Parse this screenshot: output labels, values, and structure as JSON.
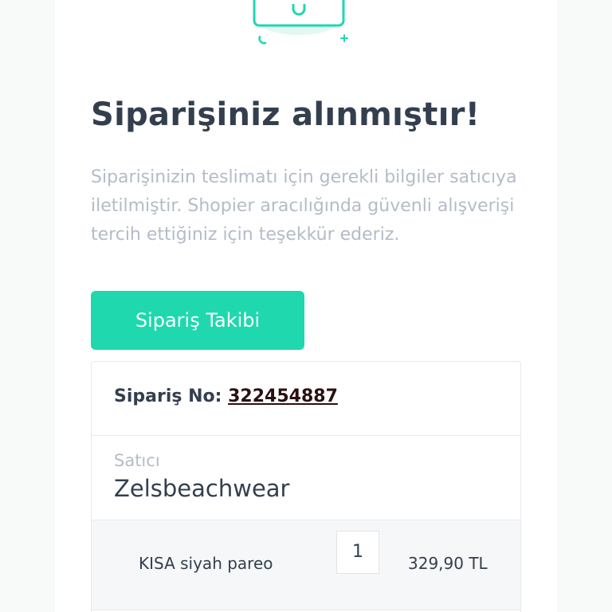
{
  "success": {
    "title": "Siparişiniz alınmıştır!",
    "message": "Siparişinizin teslimatı için gerekli bilgiler satıcıya iletilmiştir. Shopier aracılığında güvenli alışverişi tercih ettiğiniz için teşekkür ederiz.",
    "illustration_icon": "shopping-bag-icon"
  },
  "track_button": {
    "label": "Sipariş Takibi"
  },
  "order": {
    "number_label": "Sipariş No:",
    "number": "322454887",
    "seller_label": "Satıcı",
    "seller_name": "Zelsbeachwear",
    "items": [
      {
        "name": "KISA siyah pareo",
        "quantity": "1",
        "price": "329,90 TL"
      }
    ]
  },
  "colors": {
    "accent": "#1fd8ad",
    "title_text": "#333f4e",
    "muted_text": "#b3bcc8",
    "link_text": "#2a1010",
    "border": "#e6e9ed"
  }
}
